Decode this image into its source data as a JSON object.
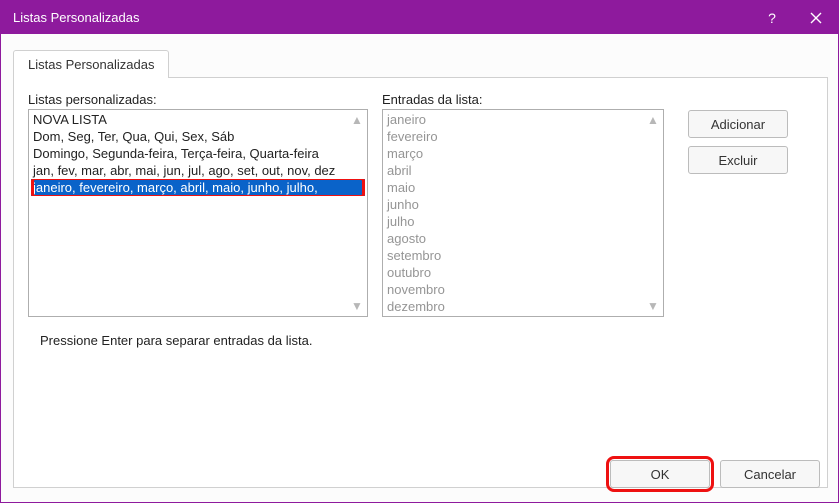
{
  "title": "Listas Personalizadas",
  "tab": "Listas Personalizadas",
  "labels": {
    "customLists": "Listas personalizadas:",
    "entries": "Entradas da lista:",
    "help": "Pressione Enter para separar entradas da lista."
  },
  "customLists": [
    "NOVA LISTA",
    "Dom, Seg, Ter, Qua, Qui, Sex, Sáb",
    "Domingo, Segunda-feira, Terça-feira, Quarta-feira",
    "jan, fev, mar, abr, mai, jun, jul, ago, set, out, nov, dez",
    "janeiro, fevereiro, março, abril, maio, junho, julho,"
  ],
  "selectedIndex": 4,
  "entries": [
    "janeiro",
    "fevereiro",
    "março",
    "abril",
    "maio",
    "junho",
    "julho",
    "agosto",
    "setembro",
    "outubro",
    "novembro",
    "dezembro"
  ],
  "buttons": {
    "add": "Adicionar",
    "delete": "Excluir",
    "ok": "OK",
    "cancel": "Cancelar"
  }
}
